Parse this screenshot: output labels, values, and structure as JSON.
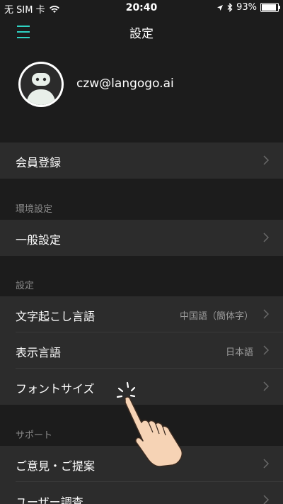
{
  "status_bar": {
    "carrier": "无 SIM 卡",
    "time": "20:40",
    "battery_percent": "93%",
    "battery_level": 0.93
  },
  "nav": {
    "title": "設定",
    "menu_icon": "hamburger-menu-icon",
    "accent_color": "#2fd3c3"
  },
  "profile": {
    "email": "czw@langogo.ai"
  },
  "membership": {
    "label": "会員登録"
  },
  "environment": {
    "header": "環境設定",
    "items": [
      {
        "label": "一般設定"
      }
    ]
  },
  "settings": {
    "header": "設定",
    "items": [
      {
        "label": "文字起こし言語",
        "value": "中国語（簡体字）"
      },
      {
        "label": "表示言語",
        "value": "日本語"
      },
      {
        "label": "フォントサイズ",
        "value": ""
      }
    ]
  },
  "support": {
    "header": "サポート",
    "items": [
      {
        "label": "ご意見・ご提案"
      },
      {
        "label": "ユーザー調査"
      }
    ]
  }
}
